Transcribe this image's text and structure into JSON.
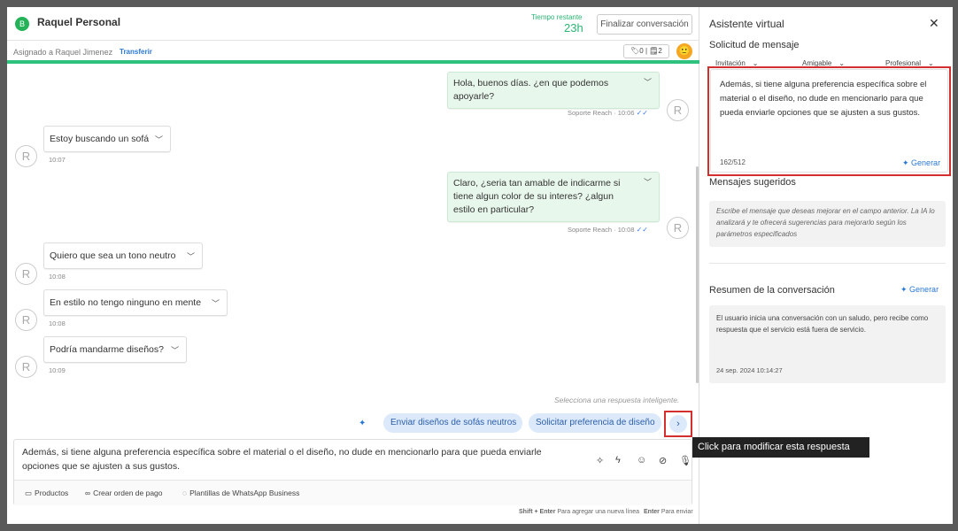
{
  "header": {
    "logo_glyph": "B",
    "contact_name": "Raquel Personal",
    "timer_label": "Tiempo restante",
    "timer_value": "23h",
    "finish_button": "Finalizar conversación"
  },
  "subheader": {
    "assigned_text": "Asignado a Raquel Jimenez",
    "transfer_link": "Transferir",
    "tag_count": "0",
    "note_count": "2"
  },
  "messages": [
    {
      "direction": "out",
      "text": "Hola, buenos días. ¿en que podemos apoyarle?",
      "sender": "Soporte Reach",
      "time": "10:06"
    },
    {
      "direction": "in",
      "text": "Estoy buscando un sofá",
      "time": "10:07"
    },
    {
      "direction": "out",
      "text": "Claro, ¿seria tan amable de indicarme si tiene algun color de su interes? ¿algun estilo en particular?",
      "sender": "Soporte Reach",
      "time": "10:08"
    },
    {
      "direction": "in",
      "text": "Quiero que sea un tono neutro",
      "time": "10:08"
    },
    {
      "direction": "in",
      "text": "En estilo no tengo ninguno en mente",
      "time": "10:08"
    },
    {
      "direction": "in",
      "text": "Podría mandarme diseños?",
      "time": "10:09"
    }
  ],
  "avatar_letter": "R",
  "smart_reply": {
    "hint": "Selecciona una respuesta inteligente.",
    "chips": [
      "Enviar diseños de sofás neutros",
      "Solicitar preferencia de diseño"
    ],
    "next_icon": "chevron-right",
    "tooltip": "Click para modificar esta respuesta"
  },
  "composer": {
    "text": "Además, si tiene alguna preferencia específica sobre el material o el diseño, no dude en mencionarlo para que pueda enviarle opciones que se ajusten a sus gustos.",
    "tools": [
      "Productos",
      "Crear orden de pago",
      "Plantillas de WhatsApp Business"
    ],
    "shortcut_newline_key": "Shift + Enter",
    "shortcut_newline_text": "Para agregar una nueva línea",
    "shortcut_send_key": "Enter",
    "shortcut_send_text": "Para enviar"
  },
  "assistant": {
    "title": "Asistente virtual",
    "request_section": "Solicitud de mensaje",
    "dropdowns": [
      "Invitación",
      "Amigable",
      "Profesional"
    ],
    "request_text": "Además, si tiene alguna preferencia específica sobre el material o el diseño, no dude en mencionarlo para que pueda enviarle opciones que se ajusten a sus gustos.",
    "char_count": "162/512",
    "generate_label": "Generar",
    "suggested_section": "Mensajes sugeridos",
    "suggested_placeholder": "Escribe el mensaje que deseas mejorar en el campo anterior. La IA lo analizará y te ofrecerá sugerencias para mejorarlo según los parámetros especificados",
    "summary_section": "Resumen de la conversación",
    "summary_text": "El usuario inicia una conversación con un saludo, pero recibe como respuesta que el servicio está fuera de servicio.",
    "summary_date": "24 sep. 2024 10:14:27"
  },
  "colors": {
    "accent_green": "#2ec27e",
    "link_blue": "#2b78d4",
    "highlight_red": "#d32f2f",
    "chip_bg": "#dce9fb"
  }
}
